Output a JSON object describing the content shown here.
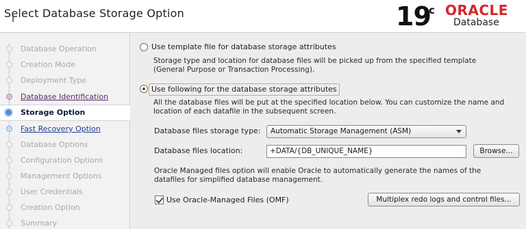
{
  "header": {
    "title": "Select Database Storage Option",
    "brand": {
      "version": "19",
      "version_suffix": "c",
      "name": "ORACLE",
      "product": "Database",
      "accent_color": "#d3262c"
    }
  },
  "sidebar": {
    "items": [
      {
        "label": "Database Operation",
        "state": "done"
      },
      {
        "label": "Creation Mode",
        "state": "done"
      },
      {
        "label": "Deployment Type",
        "state": "done"
      },
      {
        "label": "Database Identification",
        "state": "visited"
      },
      {
        "label": "Storage Option",
        "state": "current"
      },
      {
        "label": "Fast Recovery Option",
        "state": "link"
      },
      {
        "label": "Database Options",
        "state": "disabled"
      },
      {
        "label": "Configuration Options",
        "state": "disabled"
      },
      {
        "label": "Management Options",
        "state": "disabled"
      },
      {
        "label": "User Credentials",
        "state": "disabled"
      },
      {
        "label": "Creation Option",
        "state": "disabled"
      },
      {
        "label": "Summary",
        "state": "disabled"
      }
    ]
  },
  "main": {
    "option1": {
      "label": "Use template file for database storage attributes",
      "selected": false,
      "description": "Storage type and location for database files will be picked up from the specified template (General Purpose or Transaction Processing)."
    },
    "option2": {
      "label": "Use following for the database storage attributes",
      "selected": true,
      "description": "All the database files will be put at the specified location below. You can customize the name and location of each datafile in the subsequent screen."
    },
    "storage_type": {
      "label": "Database files storage type:",
      "value": "Automatic Storage Management (ASM)"
    },
    "location": {
      "label": "Database files location:",
      "value": "+DATA/{DB_UNIQUE_NAME}",
      "browse_label": "Browse..."
    },
    "omf_description": "Oracle Managed files option will enable Oracle to automatically generate the names of the datafiles for simplified database management.",
    "omf_checkbox": {
      "label": "Use Oracle-Managed Files (OMF)",
      "checked": true
    },
    "multiplex_button": "Multiplex redo logs and control files..."
  }
}
